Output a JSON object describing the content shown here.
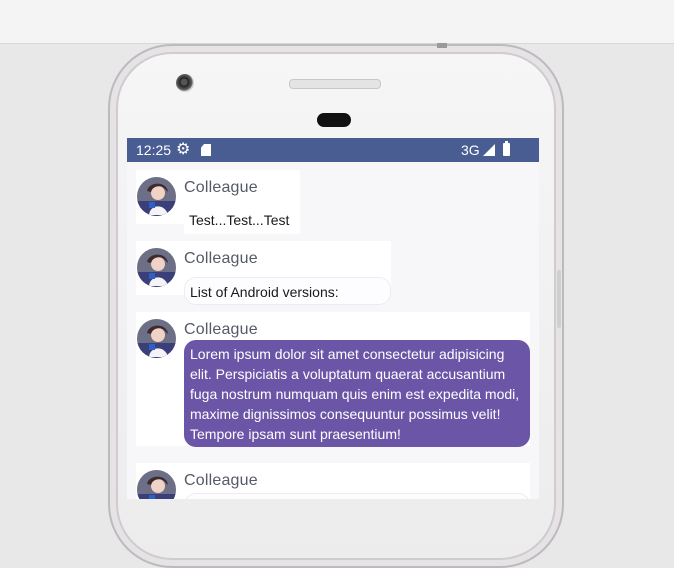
{
  "status_bar": {
    "time": "12:25",
    "network": "3G",
    "icons": [
      "gear-icon",
      "sd-card-icon",
      "signal-icon",
      "battery-icon"
    ]
  },
  "messages": [
    {
      "sender": "Colleague",
      "text": "Test...Test...Test"
    },
    {
      "sender": "Colleague",
      "text": "List of Android versions:"
    },
    {
      "sender": "Colleague",
      "text": "Lorem ipsum dolor sit amet consectetur adipisicing elit. Perspiciatis a voluptatum quaerat accusantium fuga nostrum numquam quis enim est expedita modi, maxime dignissimos consequuntur possimus velit! Tempore ipsam sunt praesentium!"
    },
    {
      "sender": "Colleague",
      "text": ""
    }
  ],
  "colors": {
    "status_bar": "#4a5d93",
    "bubble_highlight": "#6a55a7"
  }
}
